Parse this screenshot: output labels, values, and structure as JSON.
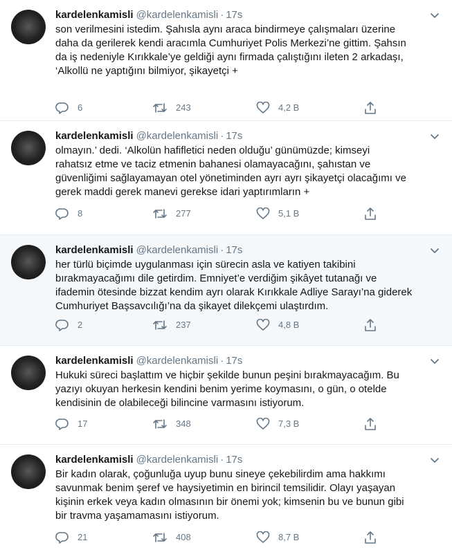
{
  "tweets": [
    {
      "name": "kardelenkamisli",
      "handle": "@kardelenkamisli",
      "sep": "·",
      "time": "17s",
      "text": "son verilmesini istedim. Şahısla aynı araca bindirmeye çalışmaları üzerine\ndaha da gerilerek kendi aracımla Cumhuriyet Polis Merkezi’ne gittim. Şahsın\nda iş nedeniyle Kırıkkale’ye geldiği aynı firmada çalıştığını ileten 2 arkadaşı,\n‘Alkollü ne yaptığını bilmiyor, şikayetçi +",
      "replies": "6",
      "retweets": "243",
      "likes": "4,2 B"
    },
    {
      "name": "kardelenkamisli",
      "handle": "@kardelenkamisli",
      "sep": "·",
      "time": "17s",
      "text": "olmayın.’  dedi. ‘Alkolün hafifletici neden olduğu’ günümüzde; kimseyi\nrahatsız etme ve taciz etmenin bahanesi olamayacağını, şahıstan ve\ngüvenliğimi sağlayamayan otel yönetiminden ayrı ayrı şikayetçi olacağımı ve\ngerek maddi gerek manevi gerekse idari yaptırımların +",
      "replies": "8",
      "retweets": "277",
      "likes": "5,1 B"
    },
    {
      "name": "kardelenkamisli",
      "handle": "@kardelenkamisli",
      "sep": "·",
      "time": "17s",
      "text": "her türlü biçimde uygulanması için sürecin asla ve katiyen takibini\nbırakmayacağımı dile getirdim. Emniyet’e verdiğim şikâyet tutanağı ve\nifademin ötesinde bizzat kendim ayrı olarak Kırıkkale Adliye Sarayı’na giderek\nCumhuriyet Başsavcılığı’na da şikayet dilekçemi ulaştırdım.",
      "replies": "2",
      "retweets": "237",
      "likes": "4,8 B"
    },
    {
      "name": "kardelenkamisli",
      "handle": "@kardelenkamisli",
      "sep": "·",
      "time": "17s",
      "text": "Hukuki süreci başlattım ve hiçbir şekilde bunun peşini bırakmayacağım. Bu\nyazıyı okuyan herkesin kendini benim yerime koymasını, o gün, o otelde\nkendisinin de olabileceği bilincine varmasını istiyorum.",
      "replies": "17",
      "retweets": "348",
      "likes": "7,3 B"
    },
    {
      "name": "kardelenkamisli",
      "handle": "@kardelenkamisli",
      "sep": "·",
      "time": "17s",
      "text": "Bir kadın olarak, çoğunluğa uyup bunu sineye çekebilirdim ama hakkımı\nsavunmak benim şeref ve haysiyetimin en birincil temsilidir. Olayı yaşayan\nkişinin erkek veya kadın olmasının bir önemi yok; kimsenin bu ve bunun gibi\nbir travma yaşamamasını istiyorum.",
      "replies": "21",
      "retweets": "408",
      "likes": "8,7 B"
    }
  ],
  "icons": {
    "reply": "reply-icon",
    "retweet": "retweet-icon",
    "like": "heart-icon",
    "share": "share-icon",
    "more": "chevron-down-icon"
  },
  "colors": {
    "text": "#14171a",
    "secondary": "#657786",
    "divider": "#e6ecf0",
    "highlight": "#f5f8fa"
  }
}
